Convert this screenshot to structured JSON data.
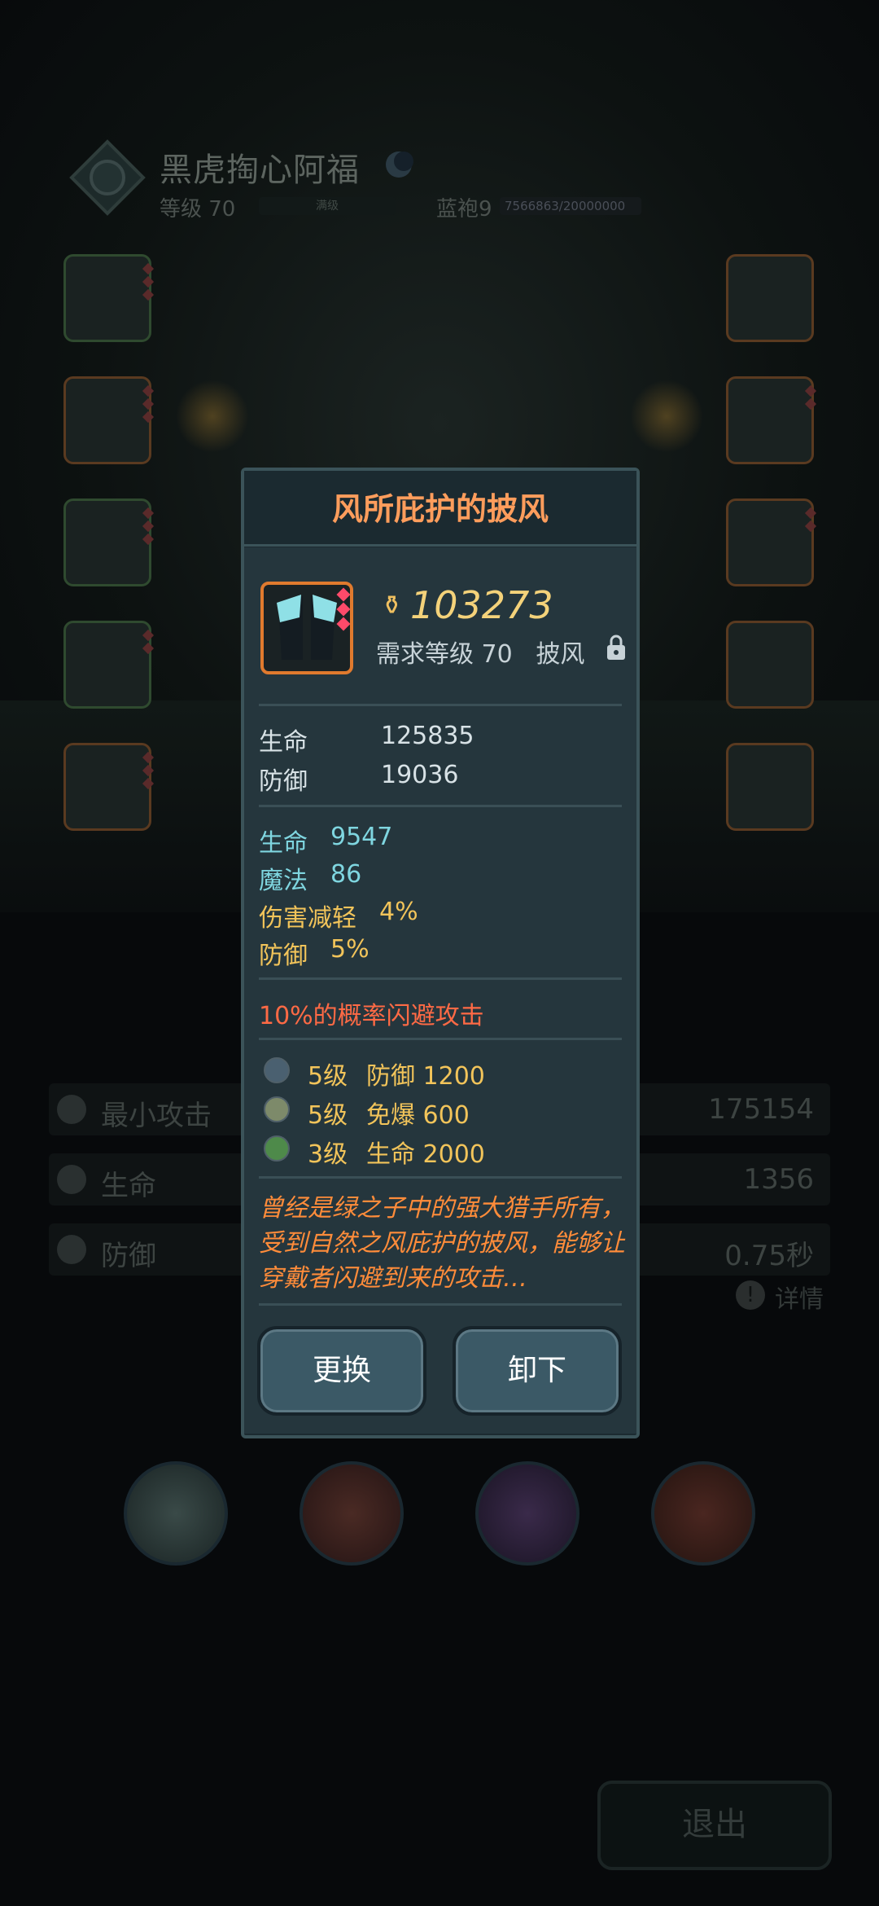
{
  "hero": {
    "name": "黑虎掏心阿福",
    "level_label": "等级 70",
    "level_bar_label": "满级",
    "rank_label": "蓝袍9",
    "rank_progress": "7566863/20000000"
  },
  "stats": [
    {
      "label": "最小攻击",
      "value": "175154",
      "icon": "attack-icon"
    },
    {
      "label": "生命",
      "value": "1356",
      "icon": "heart-icon"
    },
    {
      "label": "防御",
      "value": "0.75秒",
      "icon": "shield-icon"
    }
  ],
  "detail_label": "详情",
  "exit_label": "退出",
  "item": {
    "title": "风所庇护的披风",
    "power": "103273",
    "requirement": "需求等级 70",
    "slot_type": "披风",
    "base_stats": [
      {
        "name": "生命",
        "value": "125835"
      },
      {
        "name": "防御",
        "value": "19036"
      }
    ],
    "bonus_stats": [
      {
        "name": "生命",
        "value": "9547",
        "color": "#7fd6e0"
      },
      {
        "name": "魔法",
        "value": "86",
        "color": "#7fd6e0"
      },
      {
        "name": "伤害减轻",
        "value": "4%",
        "color": "#f2c45a"
      },
      {
        "name": "防御",
        "value": "5%",
        "color": "#f2c45a"
      }
    ],
    "special": "10%的概率闪避攻击",
    "sockets": [
      {
        "level": "5级",
        "effect": "防御 1200"
      },
      {
        "level": "5级",
        "effect": "免爆 600"
      },
      {
        "level": "3级",
        "effect": "生命 2000"
      }
    ],
    "description": "曾经是绿之子中的强大猎手所有，受到自然之风庇护的披风，能够让穿戴者闪避到来的攻击…",
    "buttons": {
      "replace": "更换",
      "unequip": "卸下"
    }
  },
  "colors": {
    "title": "#ff9d5c",
    "power": "#f4d27a",
    "special": "#ff6a45",
    "description": "#ff8c3a"
  }
}
